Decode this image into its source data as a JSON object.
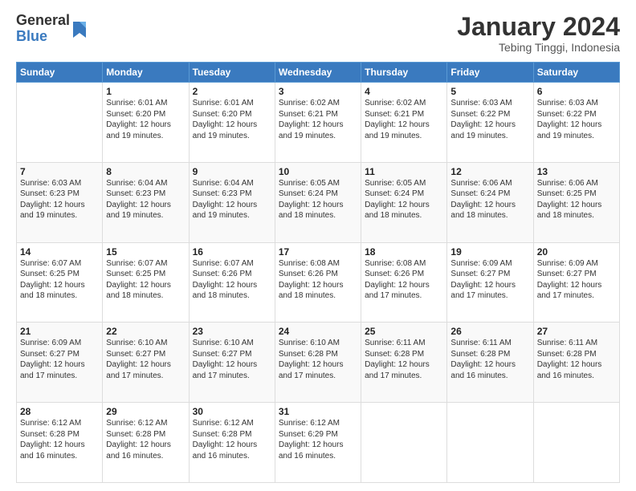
{
  "logo": {
    "general": "General",
    "blue": "Blue"
  },
  "header": {
    "month": "January 2024",
    "location": "Tebing Tinggi, Indonesia"
  },
  "weekdays": [
    "Sunday",
    "Monday",
    "Tuesday",
    "Wednesday",
    "Thursday",
    "Friday",
    "Saturday"
  ],
  "weeks": [
    [
      {
        "day": "",
        "sunrise": "",
        "sunset": "",
        "daylight": ""
      },
      {
        "day": "1",
        "sunrise": "Sunrise: 6:01 AM",
        "sunset": "Sunset: 6:20 PM",
        "daylight": "Daylight: 12 hours and 19 minutes."
      },
      {
        "day": "2",
        "sunrise": "Sunrise: 6:01 AM",
        "sunset": "Sunset: 6:20 PM",
        "daylight": "Daylight: 12 hours and 19 minutes."
      },
      {
        "day": "3",
        "sunrise": "Sunrise: 6:02 AM",
        "sunset": "Sunset: 6:21 PM",
        "daylight": "Daylight: 12 hours and 19 minutes."
      },
      {
        "day": "4",
        "sunrise": "Sunrise: 6:02 AM",
        "sunset": "Sunset: 6:21 PM",
        "daylight": "Daylight: 12 hours and 19 minutes."
      },
      {
        "day": "5",
        "sunrise": "Sunrise: 6:03 AM",
        "sunset": "Sunset: 6:22 PM",
        "daylight": "Daylight: 12 hours and 19 minutes."
      },
      {
        "day": "6",
        "sunrise": "Sunrise: 6:03 AM",
        "sunset": "Sunset: 6:22 PM",
        "daylight": "Daylight: 12 hours and 19 minutes."
      }
    ],
    [
      {
        "day": "7",
        "sunrise": "Sunrise: 6:03 AM",
        "sunset": "Sunset: 6:23 PM",
        "daylight": "Daylight: 12 hours and 19 minutes."
      },
      {
        "day": "8",
        "sunrise": "Sunrise: 6:04 AM",
        "sunset": "Sunset: 6:23 PM",
        "daylight": "Daylight: 12 hours and 19 minutes."
      },
      {
        "day": "9",
        "sunrise": "Sunrise: 6:04 AM",
        "sunset": "Sunset: 6:23 PM",
        "daylight": "Daylight: 12 hours and 19 minutes."
      },
      {
        "day": "10",
        "sunrise": "Sunrise: 6:05 AM",
        "sunset": "Sunset: 6:24 PM",
        "daylight": "Daylight: 12 hours and 18 minutes."
      },
      {
        "day": "11",
        "sunrise": "Sunrise: 6:05 AM",
        "sunset": "Sunset: 6:24 PM",
        "daylight": "Daylight: 12 hours and 18 minutes."
      },
      {
        "day": "12",
        "sunrise": "Sunrise: 6:06 AM",
        "sunset": "Sunset: 6:24 PM",
        "daylight": "Daylight: 12 hours and 18 minutes."
      },
      {
        "day": "13",
        "sunrise": "Sunrise: 6:06 AM",
        "sunset": "Sunset: 6:25 PM",
        "daylight": "Daylight: 12 hours and 18 minutes."
      }
    ],
    [
      {
        "day": "14",
        "sunrise": "Sunrise: 6:07 AM",
        "sunset": "Sunset: 6:25 PM",
        "daylight": "Daylight: 12 hours and 18 minutes."
      },
      {
        "day": "15",
        "sunrise": "Sunrise: 6:07 AM",
        "sunset": "Sunset: 6:25 PM",
        "daylight": "Daylight: 12 hours and 18 minutes."
      },
      {
        "day": "16",
        "sunrise": "Sunrise: 6:07 AM",
        "sunset": "Sunset: 6:26 PM",
        "daylight": "Daylight: 12 hours and 18 minutes."
      },
      {
        "day": "17",
        "sunrise": "Sunrise: 6:08 AM",
        "sunset": "Sunset: 6:26 PM",
        "daylight": "Daylight: 12 hours and 18 minutes."
      },
      {
        "day": "18",
        "sunrise": "Sunrise: 6:08 AM",
        "sunset": "Sunset: 6:26 PM",
        "daylight": "Daylight: 12 hours and 17 minutes."
      },
      {
        "day": "19",
        "sunrise": "Sunrise: 6:09 AM",
        "sunset": "Sunset: 6:27 PM",
        "daylight": "Daylight: 12 hours and 17 minutes."
      },
      {
        "day": "20",
        "sunrise": "Sunrise: 6:09 AM",
        "sunset": "Sunset: 6:27 PM",
        "daylight": "Daylight: 12 hours and 17 minutes."
      }
    ],
    [
      {
        "day": "21",
        "sunrise": "Sunrise: 6:09 AM",
        "sunset": "Sunset: 6:27 PM",
        "daylight": "Daylight: 12 hours and 17 minutes."
      },
      {
        "day": "22",
        "sunrise": "Sunrise: 6:10 AM",
        "sunset": "Sunset: 6:27 PM",
        "daylight": "Daylight: 12 hours and 17 minutes."
      },
      {
        "day": "23",
        "sunrise": "Sunrise: 6:10 AM",
        "sunset": "Sunset: 6:27 PM",
        "daylight": "Daylight: 12 hours and 17 minutes."
      },
      {
        "day": "24",
        "sunrise": "Sunrise: 6:10 AM",
        "sunset": "Sunset: 6:28 PM",
        "daylight": "Daylight: 12 hours and 17 minutes."
      },
      {
        "day": "25",
        "sunrise": "Sunrise: 6:11 AM",
        "sunset": "Sunset: 6:28 PM",
        "daylight": "Daylight: 12 hours and 17 minutes."
      },
      {
        "day": "26",
        "sunrise": "Sunrise: 6:11 AM",
        "sunset": "Sunset: 6:28 PM",
        "daylight": "Daylight: 12 hours and 16 minutes."
      },
      {
        "day": "27",
        "sunrise": "Sunrise: 6:11 AM",
        "sunset": "Sunset: 6:28 PM",
        "daylight": "Daylight: 12 hours and 16 minutes."
      }
    ],
    [
      {
        "day": "28",
        "sunrise": "Sunrise: 6:12 AM",
        "sunset": "Sunset: 6:28 PM",
        "daylight": "Daylight: 12 hours and 16 minutes."
      },
      {
        "day": "29",
        "sunrise": "Sunrise: 6:12 AM",
        "sunset": "Sunset: 6:28 PM",
        "daylight": "Daylight: 12 hours and 16 minutes."
      },
      {
        "day": "30",
        "sunrise": "Sunrise: 6:12 AM",
        "sunset": "Sunset: 6:28 PM",
        "daylight": "Daylight: 12 hours and 16 minutes."
      },
      {
        "day": "31",
        "sunrise": "Sunrise: 6:12 AM",
        "sunset": "Sunset: 6:29 PM",
        "daylight": "Daylight: 12 hours and 16 minutes."
      },
      {
        "day": "",
        "sunrise": "",
        "sunset": "",
        "daylight": ""
      },
      {
        "day": "",
        "sunrise": "",
        "sunset": "",
        "daylight": ""
      },
      {
        "day": "",
        "sunrise": "",
        "sunset": "",
        "daylight": ""
      }
    ]
  ]
}
